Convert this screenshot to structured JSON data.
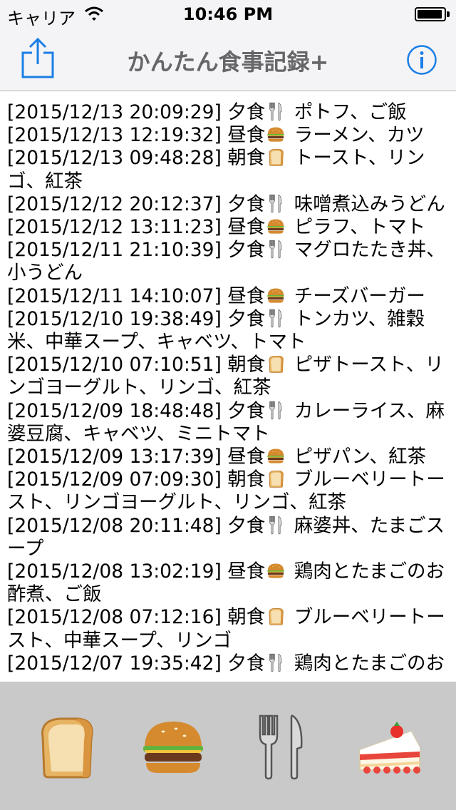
{
  "status_bar": {
    "carrier": "キャリア",
    "time": "10:46 PM",
    "battery_level": 0.95
  },
  "nav_bar": {
    "title": "かんたん食事記録+",
    "left_icon": "share-icon",
    "right_icon": "info-icon"
  },
  "colors": {
    "accent": "#1a7ee6",
    "bar": "#f4f4f6",
    "tabbar": "#c9c9c9",
    "title": "#666669"
  },
  "meal_icons": {
    "朝食": "bread-icon",
    "昼食": "burger-icon",
    "夕食": "fork-knife-icon"
  },
  "entries": [
    {
      "ts": "[2015/12/13 20:09:29]",
      "meal": "夕食",
      "text": "ポトフ、ご飯"
    },
    {
      "ts": "[2015/12/13 12:19:32]",
      "meal": "昼食",
      "text": "ラーメン、カツ"
    },
    {
      "ts": "[2015/12/13 09:48:28]",
      "meal": "朝食",
      "text": "トースト、リンゴ、紅茶"
    },
    {
      "ts": "[2015/12/12 20:12:37]",
      "meal": "夕食",
      "text": "味噌煮込みうどん"
    },
    {
      "ts": "[2015/12/12 13:11:23]",
      "meal": "昼食",
      "text": "ピラフ、トマト"
    },
    {
      "ts": "[2015/12/11 21:10:39]",
      "meal": "夕食",
      "text": "マグロたたき丼、小うどん"
    },
    {
      "ts": "[2015/12/11 14:10:07]",
      "meal": "昼食",
      "text": "チーズバーガー"
    },
    {
      "ts": "[2015/12/10 19:38:49]",
      "meal": "夕食",
      "text": "トンカツ、雑穀米、中華スープ、キャベツ、トマト"
    },
    {
      "ts": "[2015/12/10 07:10:51]",
      "meal": "朝食",
      "text": "ピザトースト、リンゴヨーグルト、リンゴ、紅茶"
    },
    {
      "ts": "[2015/12/09 18:48:48]",
      "meal": "夕食",
      "text": "カレーライス、麻婆豆腐、キャベツ、ミニトマト"
    },
    {
      "ts": "[2015/12/09 13:17:39]",
      "meal": "昼食",
      "text": "ピザパン、紅茶"
    },
    {
      "ts": "[2015/12/09 07:09:30]",
      "meal": "朝食",
      "text": "ブルーベリートースト、リンゴヨーグルト、リンゴ、紅茶"
    },
    {
      "ts": "[2015/12/08 20:11:48]",
      "meal": "夕食",
      "text": "麻婆丼、たまごスープ"
    },
    {
      "ts": "[2015/12/08 13:02:19]",
      "meal": "昼食",
      "text": "鶏肉とたまごのお酢煮、ご飯"
    },
    {
      "ts": "[2015/12/08 07:12:16]",
      "meal": "朝食",
      "text": "ブルーベリートースト、中華スープ、リンゴ"
    },
    {
      "ts": "[2015/12/07 19:35:42]",
      "meal": "夕食",
      "text": "鶏肉とたまごのお"
    }
  ],
  "tab_bar": {
    "buttons": [
      {
        "name": "breakfast-button",
        "icon": "bread-icon"
      },
      {
        "name": "lunch-button",
        "icon": "burger-icon"
      },
      {
        "name": "dinner-button",
        "icon": "fork-knife-icon"
      },
      {
        "name": "snack-button",
        "icon": "cake-icon"
      }
    ]
  }
}
